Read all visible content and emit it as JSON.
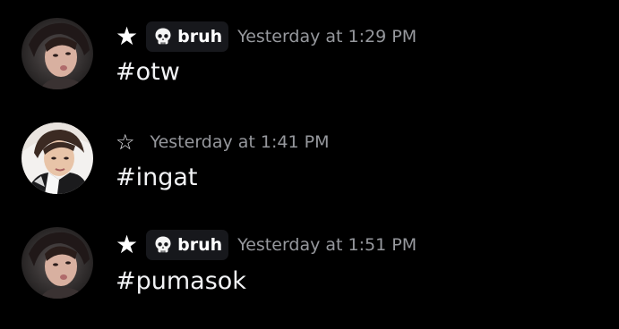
{
  "messages": [
    {
      "username": "★",
      "tag_text": "bruh",
      "tag_icon": "skull-icon",
      "timestamp": "Yesterday at 1:29 PM",
      "content": "#otw",
      "avatar": "avatar-photo-1"
    },
    {
      "username": "☆",
      "timestamp": "Yesterday at 1:41 PM",
      "content": "#ingat",
      "avatar": "avatar-photo-2"
    },
    {
      "username": "★",
      "tag_text": "bruh",
      "tag_icon": "skull-icon",
      "timestamp": "Yesterday at 1:51 PM",
      "content": "#pumasok",
      "avatar": "avatar-photo-1"
    }
  ],
  "colors": {
    "background": "#000000",
    "timestamp": "#96989d",
    "tag_background": "#17181c",
    "text": "#f2f3f5"
  }
}
